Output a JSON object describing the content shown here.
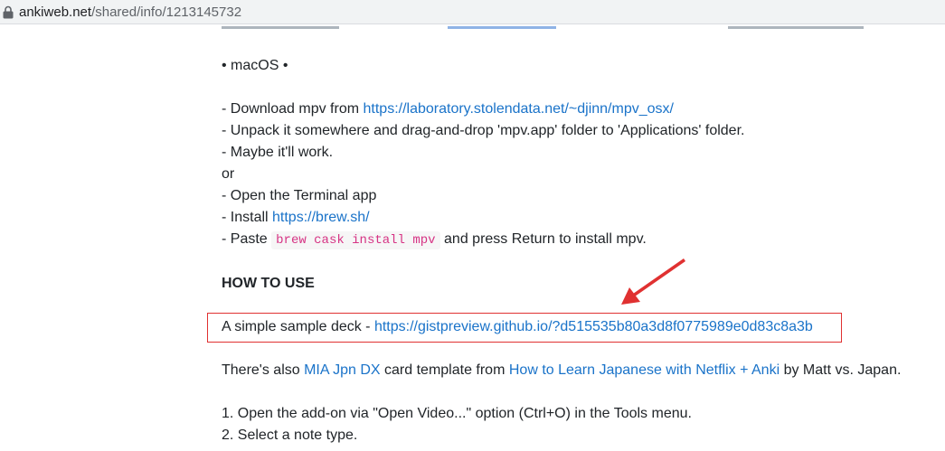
{
  "browser": {
    "url_host": "ankiweb.net",
    "url_path": "/shared/info/1213145732"
  },
  "content": {
    "macos_heading": "• macOS •",
    "download_prefix": "- Download mpv from ",
    "download_link": "https://laboratory.stolendata.net/~djinn/mpv_osx/",
    "unpack_line": "- Unpack it somewhere and drag-and-drop 'mpv.app' folder to 'Applications' folder.",
    "maybe_line": "- Maybe it'll work.",
    "or_line": "or",
    "terminal_line": "- Open the Terminal app",
    "install_prefix": "- Install ",
    "install_link": "https://brew.sh/",
    "paste_prefix": "- Paste ",
    "paste_code": "brew cask install mpv",
    "paste_suffix": " and press Return to install mpv.",
    "howto_heading": "HOW TO USE",
    "sample_prefix": "A simple sample deck - ",
    "sample_link": "https://gistpreview.github.io/?d515535b80a3d8f0775989e0d83c8a3b",
    "also_prefix": "There's also ",
    "also_link1": "MIA Jpn DX",
    "also_middle": " card template from ",
    "also_link2": "How to Learn Japanese with Netflix + Anki",
    "also_suffix": " by Matt vs. Japan.",
    "step1": "1. Open the add-on via \"Open Video...\" option (Ctrl+O) in the Tools menu.",
    "step2": "2. Select a note type."
  },
  "annotation": {
    "box_color": "#e03131",
    "arrow_color": "#e03131"
  },
  "icons": {
    "lock": "lock-icon"
  }
}
